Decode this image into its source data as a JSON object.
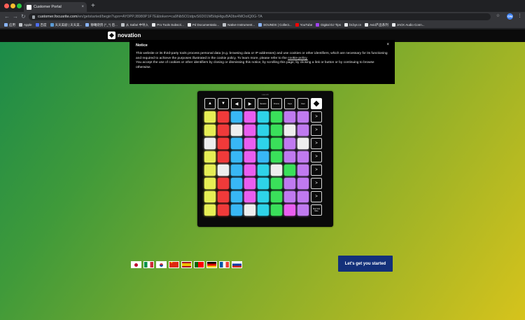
{
  "browser": {
    "tab_title": "Customer Portal",
    "tab_close": "×",
    "new_tab": "+",
    "back": "←",
    "forward": "→",
    "reload": "↻",
    "url_host": "customer.focusrite.com",
    "url_rest": "/en/getstarted/begin?upn=AY0PPJ8980P1F7E&token=ca9Nb5O1tdpvS6D01M5ilqHtguBA0bx4MOolQ0G-TA",
    "star": "☆",
    "ext_label": "ON",
    "menu": "⋮",
    "bookmarks": [
      {
        "label": "应用",
        "color": "#8ab4f8"
      },
      {
        "label": "Apple",
        "color": "#bdc1c6"
      },
      {
        "label": "百度",
        "color": "#4e6ef2"
      },
      {
        "label": "天天美剧 | 天天美...",
        "color": "#5b9bd5"
      },
      {
        "label": "静曦烧鸽 (^_^) 后...",
        "color": "#8ab4f8"
      },
      {
        "label": "从 Safari 中导入",
        "color": "#bdc1c6"
      },
      {
        "label": "Pro Tools Subscri...",
        "color": "#e8eaed"
      },
      {
        "label": "Pd Documentatio...",
        "color": "#e8eaed"
      },
      {
        "label": "Native Instrument...",
        "color": "#bdc1c6"
      },
      {
        "label": "SOUNDS | Collect...",
        "color": "#8ab4f8"
      },
      {
        "label": "YouTube",
        "color": "#ff0000"
      },
      {
        "label": "Digital DJ Tips",
        "color": "#a142f4"
      },
      {
        "label": "bt.byr.cn",
        "color": "#e8eaed"
      },
      {
        "label": "Avid产品系列",
        "color": "#e8eaed"
      },
      {
        "label": "JACK Audio Conn...",
        "color": "#e8eaed"
      }
    ]
  },
  "site": {
    "logo_text": "novation",
    "cta_label": "Let's get you started"
  },
  "notice": {
    "title": "Notice",
    "close": "×",
    "paragraph1": "This website or its third-party tools process personal data (e.g. browsing data or IP addresses) and use cookies or other identifiers, which are necessary for its functioning and required to achieve the purposes illustrated in the cookie policy. To learn more, please refer to the",
    "link_text": "cookie policy.",
    "paragraph2": "You accept the use of cookies or other identifiers by closing or dismissing this notice, by scrolling this page, by clicking a link or button or by continuing to browse otherwise."
  },
  "launchpad": {
    "brand": "Launch",
    "top_buttons": [
      "▲",
      "▼",
      "◀",
      "▶",
      "Session",
      "Drums",
      "Keys",
      "User"
    ],
    "side_buttons": [
      ">",
      ">",
      ">",
      ">",
      ">",
      ">",
      ">",
      "Stop Solo Mute"
    ],
    "pad_colors": {
      "Y": "#e6ee55",
      "R": "#f03a3a",
      "W": "#eeeeee",
      "B": "#38b7f5",
      "M": "#ea5ef0",
      "C": "#2ed3e8",
      "G": "#3ae05a",
      "P": "#c07af0"
    },
    "pad_rows": [
      "YRBMCGPP",
      "YRWMCGWP",
      "WRBMCGPW",
      "YRBMBGPP",
      "YWBMCWGP",
      "YRBMCGPP",
      "YRBMCGPP",
      "YRBWCGMP"
    ]
  },
  "flags": [
    "jp",
    "it",
    "kr",
    "cn",
    "es",
    "pt",
    "de",
    "fr",
    "ru"
  ]
}
